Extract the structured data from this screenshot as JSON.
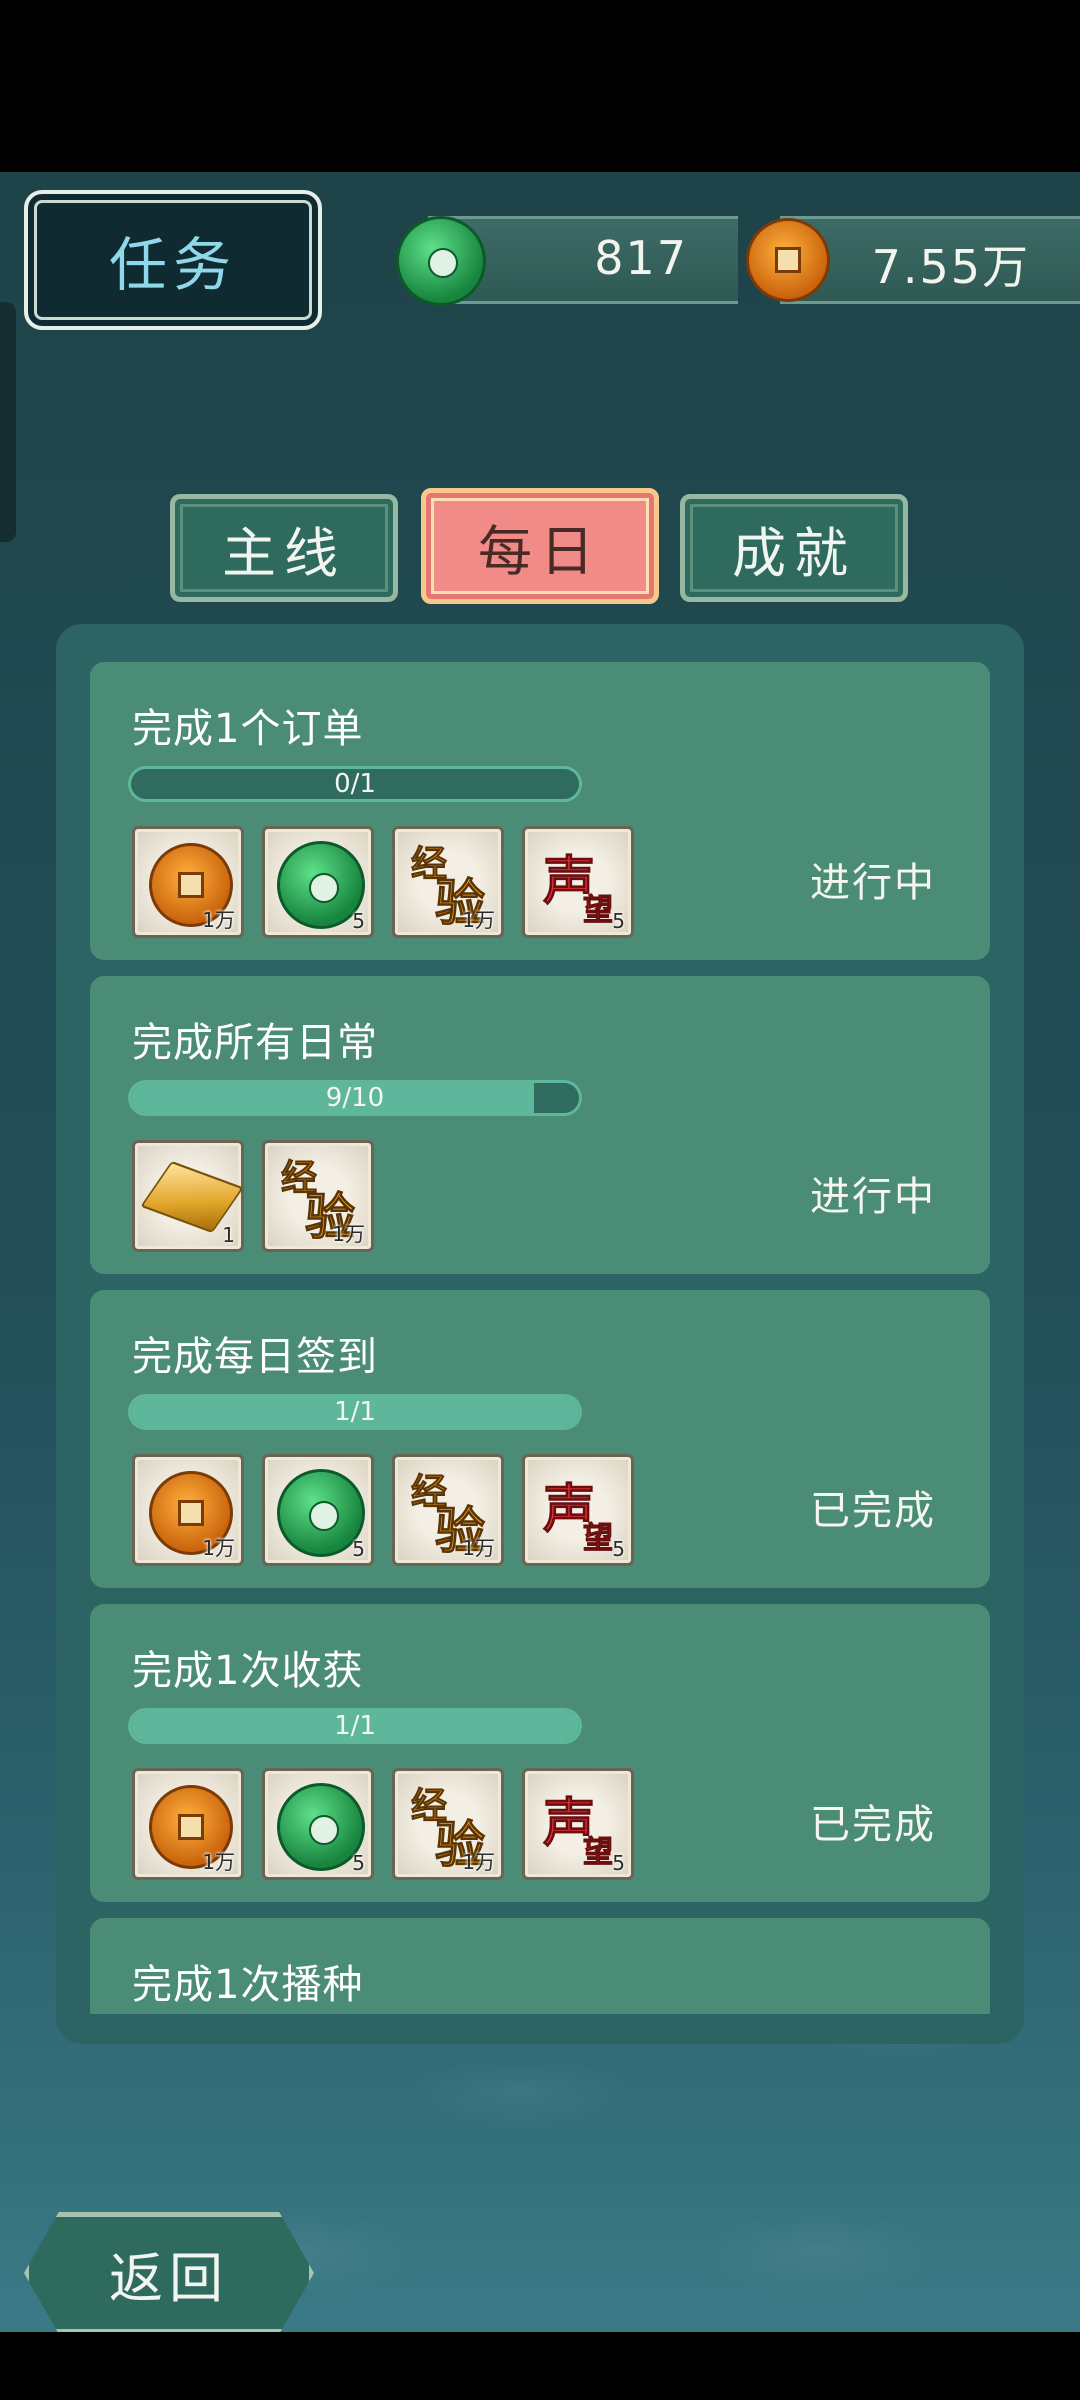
{
  "header": {
    "title": "任务",
    "currencies": [
      {
        "icon": "jade-icon",
        "value": "817"
      },
      {
        "icon": "coin-icon",
        "value": "7.55万"
      }
    ]
  },
  "tabs": [
    {
      "label": "主线",
      "active": false
    },
    {
      "label": "每日",
      "active": true
    },
    {
      "label": "成就",
      "active": false
    }
  ],
  "tasks": [
    {
      "title": "完成1个订单",
      "progress": {
        "current": 0,
        "total": 1,
        "text": "0/1"
      },
      "rewards": [
        {
          "icon": "copper-coin-icon",
          "qty": "1万"
        },
        {
          "icon": "jade-disc-icon",
          "qty": "5"
        },
        {
          "icon": "experience-icon",
          "qty": "1万"
        },
        {
          "icon": "reputation-icon",
          "qty": "5"
        }
      ],
      "status": "进行中"
    },
    {
      "title": "完成所有日常",
      "progress": {
        "current": 9,
        "total": 10,
        "text": "9/10"
      },
      "rewards": [
        {
          "icon": "gold-bar-icon",
          "qty": "1"
        },
        {
          "icon": "experience-icon",
          "qty": "1万"
        }
      ],
      "status": "进行中"
    },
    {
      "title": "完成每日签到",
      "progress": {
        "current": 1,
        "total": 1,
        "text": "1/1"
      },
      "rewards": [
        {
          "icon": "copper-coin-icon",
          "qty": "1万"
        },
        {
          "icon": "jade-disc-icon",
          "qty": "5"
        },
        {
          "icon": "experience-icon",
          "qty": "1万"
        },
        {
          "icon": "reputation-icon",
          "qty": "5"
        }
      ],
      "status": "已完成"
    },
    {
      "title": "完成1次收获",
      "progress": {
        "current": 1,
        "total": 1,
        "text": "1/1"
      },
      "rewards": [
        {
          "icon": "copper-coin-icon",
          "qty": "1万"
        },
        {
          "icon": "jade-disc-icon",
          "qty": "5"
        },
        {
          "icon": "experience-icon",
          "qty": "1万"
        },
        {
          "icon": "reputation-icon",
          "qty": "5"
        }
      ],
      "status": "已完成"
    },
    {
      "title": "完成1次播种",
      "status": ""
    }
  ],
  "back_label": "返回",
  "colors": {
    "background": "#24505a",
    "card": "#4a8c76",
    "active_tab": "#f08b88",
    "progress_fill": "#5fb79b"
  }
}
